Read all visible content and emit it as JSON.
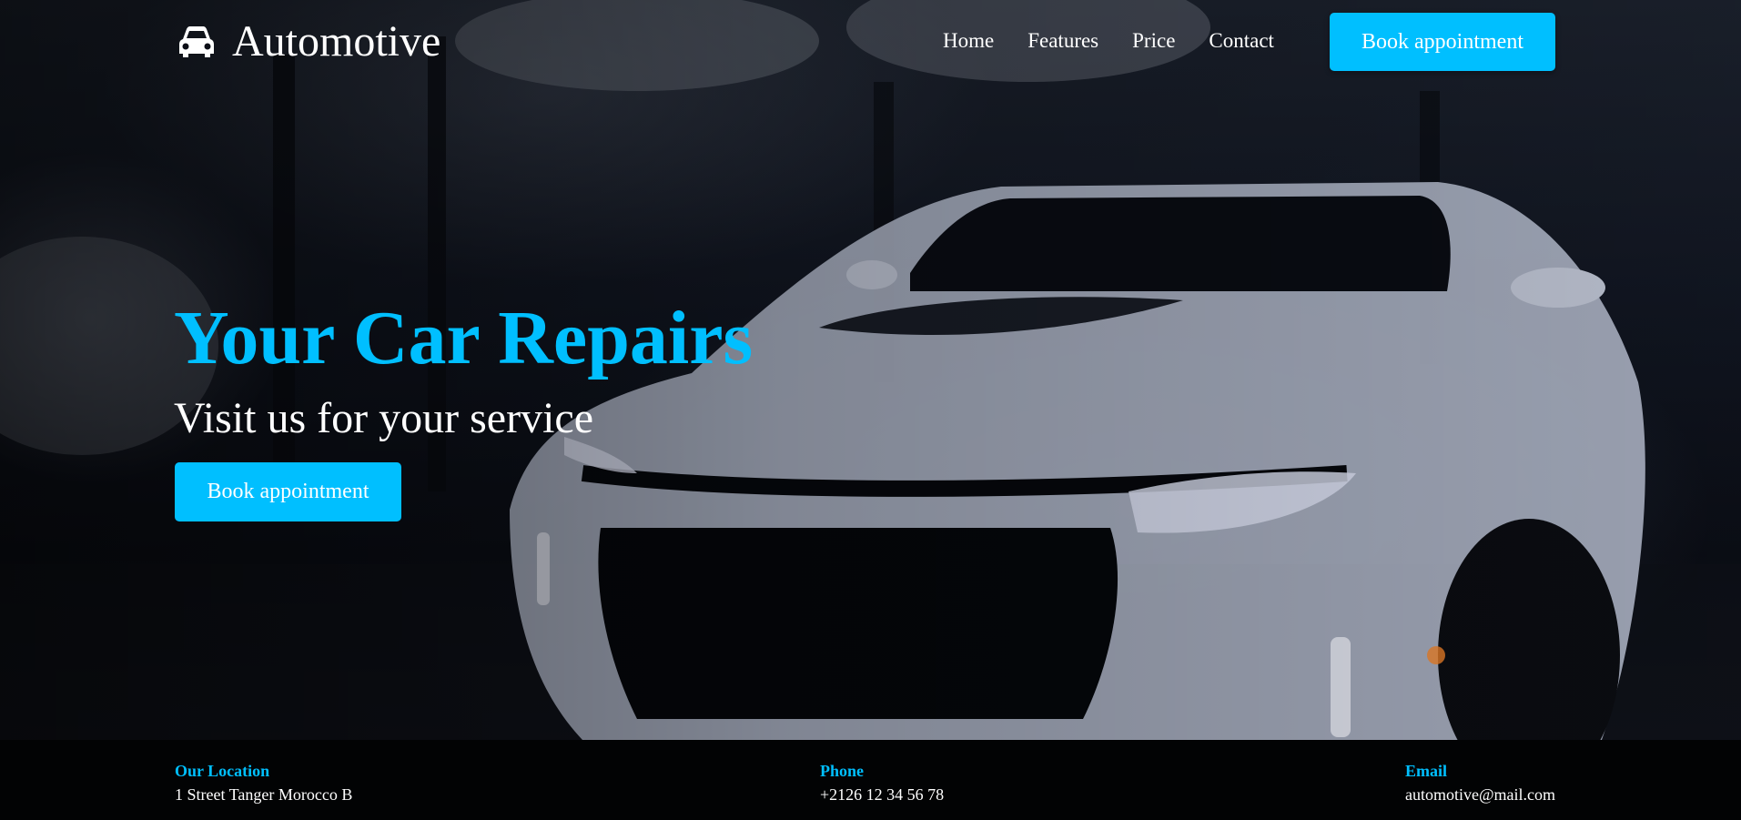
{
  "brand": {
    "name": "Automotive",
    "icon": "car-icon"
  },
  "nav": {
    "links": [
      {
        "label": "Home"
      },
      {
        "label": "Features"
      },
      {
        "label": "Price"
      },
      {
        "label": "Contact"
      }
    ],
    "cta_label": "Book appointment"
  },
  "hero": {
    "title": "Your Car Repairs",
    "subtitle": "Visit us for your service",
    "cta_label": "Book appointment"
  },
  "footer": {
    "location": {
      "title": "Our Location",
      "value": "1 Street Tanger Morocco B"
    },
    "phone": {
      "title": "Phone",
      "value": "+2126 12 34 56 78"
    },
    "email": {
      "title": "Email",
      "value": "automotive@mail.com"
    }
  },
  "colors": {
    "accent": "#00bfff",
    "footer_bg": "#020304",
    "text": "#ffffff"
  }
}
